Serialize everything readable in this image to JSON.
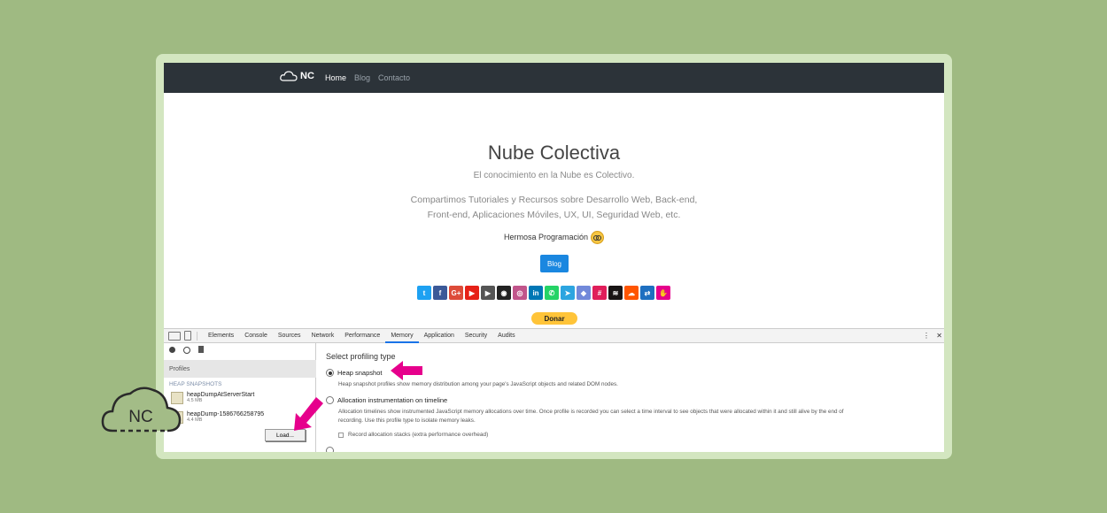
{
  "navbar": {
    "brand": "NC",
    "links": [
      {
        "label": "Home",
        "active": true
      },
      {
        "label": "Blog"
      },
      {
        "label": "Contacto"
      }
    ]
  },
  "hero": {
    "title": "Nube Colectiva",
    "subtitle": "El conocimiento en la Nube es Colectivo.",
    "description_line1": "Compartimos Tutoriales y Recursos sobre Desarrollo Web, Back-end,",
    "description_line2": "Front-end, Aplicaciones Móviles, UX, UI, Seguridad Web, etc.",
    "tagline": "Hermosa Programación",
    "blog_button": "Blog",
    "donate_button": "Donar",
    "socials": [
      {
        "icon": "twitter-icon",
        "glyph": "t",
        "color": "#1da1f2"
      },
      {
        "icon": "facebook-icon",
        "glyph": "f",
        "color": "#3b5998"
      },
      {
        "icon": "google-plus-icon",
        "glyph": "G+",
        "color": "#dd4b39"
      },
      {
        "icon": "youtube-icon",
        "glyph": "▶",
        "color": "#e62117"
      },
      {
        "icon": "video-icon",
        "glyph": "▶",
        "color": "#555555"
      },
      {
        "icon": "github-icon",
        "glyph": "◉",
        "color": "#222222"
      },
      {
        "icon": "instagram-icon",
        "glyph": "◎",
        "color": "#c1558b"
      },
      {
        "icon": "linkedin-icon",
        "glyph": "in",
        "color": "#0077b5"
      },
      {
        "icon": "whatsapp-icon",
        "glyph": "✆",
        "color": "#25d366"
      },
      {
        "icon": "telegram-icon",
        "glyph": "➤",
        "color": "#2ca5e0"
      },
      {
        "icon": "discord-icon",
        "glyph": "◆",
        "color": "#7289da"
      },
      {
        "icon": "slack-icon",
        "glyph": "#",
        "color": "#e01e5a"
      },
      {
        "icon": "spotify-icon",
        "glyph": "≋",
        "color": "#191414"
      },
      {
        "icon": "soundcloud-icon",
        "glyph": "☁",
        "color": "#ff5500"
      },
      {
        "icon": "link-icon",
        "glyph": "⇄",
        "color": "#1e6fc0"
      },
      {
        "icon": "hands-icon",
        "glyph": "✋",
        "color": "#e6008c"
      }
    ]
  },
  "devtools": {
    "tabs": [
      {
        "label": "Elements"
      },
      {
        "label": "Console"
      },
      {
        "label": "Sources"
      },
      {
        "label": "Network"
      },
      {
        "label": "Performance"
      },
      {
        "label": "Memory",
        "active": true
      },
      {
        "label": "Application"
      },
      {
        "label": "Security"
      },
      {
        "label": "Audits"
      }
    ],
    "profiles_header": "Profiles",
    "heap_header": "HEAP SNAPSHOTS",
    "snapshots": [
      {
        "name": "heapDumpAtServerStart",
        "size": "4.5 MB"
      },
      {
        "name": "heapDump-1586766258795",
        "size": "4.4 MB"
      }
    ],
    "load_button": "Load...",
    "select_title": "Select profiling type",
    "options": [
      {
        "label": "Heap snapshot",
        "checked": true,
        "desc": "Heap snapshot profiles show memory distribution among your page's JavaScript objects and related DOM nodes."
      },
      {
        "label": "Allocation instrumentation on timeline",
        "checked": false,
        "desc1": "Allocation timelines show instrumented JavaScript memory allocations over time. Once profile is recorded you can select a time interval to see objects that were allocated within it and still alive by the end of",
        "desc2": "recording. Use this profile type to isolate memory leaks."
      }
    ],
    "record_checkbox": "Record allocation stacks (extra performance overhead)"
  },
  "colors": {
    "background": "#9fba82",
    "navbar": "#2c3339",
    "accent": "#e6008c",
    "blog": "#1a87e0",
    "donate": "#ffc439"
  },
  "logo_text": "NC"
}
